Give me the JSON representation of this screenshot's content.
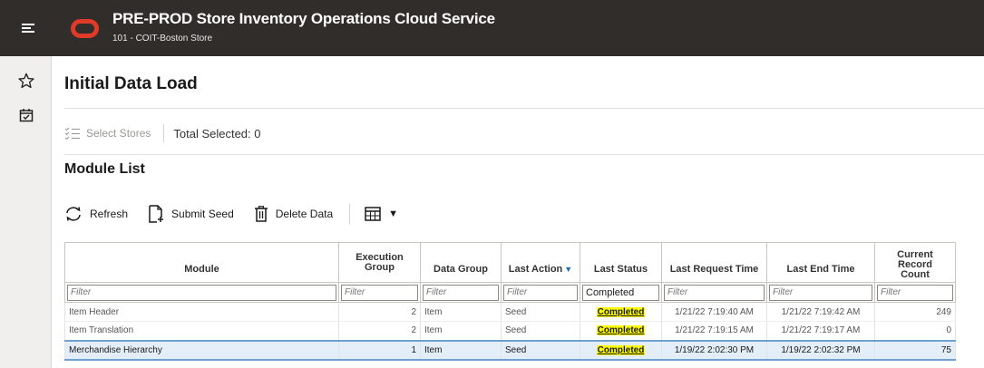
{
  "header": {
    "title": "PRE-PROD Store Inventory Operations Cloud Service",
    "subtitle": "101 - COIT-Boston Store",
    "brand_color": "#e03a28"
  },
  "rail": {
    "items": [
      {
        "icon": "star-icon"
      },
      {
        "icon": "calendar-check-icon"
      }
    ]
  },
  "page": {
    "title": "Initial Data Load",
    "select_stores_label": "Select Stores",
    "total_selected": "Total Selected: 0",
    "section_title": "Module List"
  },
  "toolbar": {
    "refresh_label": "Refresh",
    "submit_seed_label": "Submit Seed",
    "delete_data_label": "Delete Data",
    "column_menu_caret": "▼"
  },
  "table": {
    "headers": {
      "module": "Module",
      "execution_group_1": "Execution",
      "execution_group_2": "Group",
      "data_group": "Data Group",
      "last_action": "Last Action",
      "last_status": "Last Status",
      "last_request_time": "Last Request Time",
      "last_end_time": "Last End Time",
      "current_record_count_1": "Current",
      "current_record_count_2": "Record",
      "current_record_count_3": "Count"
    },
    "filters": {
      "placeholder": "Filter",
      "last_status_value": "Completed"
    },
    "rows": [
      {
        "module": "Item Header",
        "execution_group": "2",
        "data_group": "Item",
        "last_action": "Seed",
        "last_status": "Completed",
        "last_request_time": "1/21/22 7:19:40 AM",
        "last_end_time": "1/21/22 7:19:42 AM",
        "count": "249"
      },
      {
        "module": "Item Translation",
        "execution_group": "2",
        "data_group": "Item",
        "last_action": "Seed",
        "last_status": "Completed",
        "last_request_time": "1/21/22 7:19:15 AM",
        "last_end_time": "1/21/22 7:19:17 AM",
        "count": "0"
      },
      {
        "module": "Merchandise Hierarchy",
        "execution_group": "1",
        "data_group": "Item",
        "last_action": "Seed",
        "last_status": "Completed",
        "last_request_time": "1/19/22 2:02:30 PM",
        "last_end_time": "1/19/22 2:02:32 PM",
        "count": "75"
      }
    ]
  }
}
